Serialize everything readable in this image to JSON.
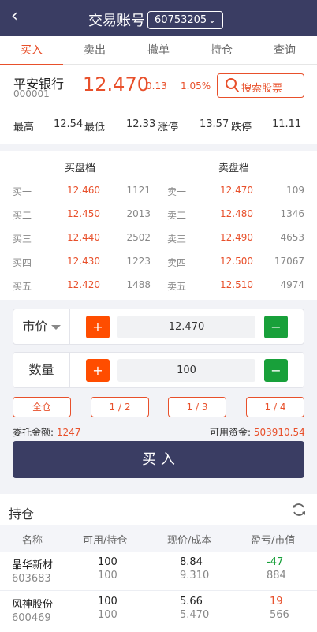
{
  "header": {
    "back_icon": "chevron-left-icon",
    "title": "交易账号",
    "account": "60753205"
  },
  "tabs": [
    "买入",
    "卖出",
    "撤单",
    "持仓",
    "查询"
  ],
  "stock": {
    "name": "平安银行",
    "code": "000001",
    "price": "12.470",
    "change": "0.13",
    "change_pct": "1.05%",
    "search_label": "搜索股票",
    "high_label": "最高",
    "high": "12.54",
    "low_label": "最低",
    "low": "12.33",
    "limit_up_label": "涨停",
    "limit_up": "13.57",
    "limit_down_label": "跌停",
    "limit_down": "11.11"
  },
  "orderbook": {
    "buy_title": "买盘档",
    "sell_title": "卖盘档",
    "buy": [
      {
        "level": "买一",
        "price": "12.460",
        "volume": "1121"
      },
      {
        "level": "买二",
        "price": "12.450",
        "volume": "2013"
      },
      {
        "level": "买三",
        "price": "12.440",
        "volume": "2502"
      },
      {
        "level": "买四",
        "price": "12.430",
        "volume": "1223"
      },
      {
        "level": "买五",
        "price": "12.420",
        "volume": "1488"
      }
    ],
    "sell": [
      {
        "level": "卖一",
        "price": "12.470",
        "volume": "109"
      },
      {
        "level": "卖二",
        "price": "12.480",
        "volume": "1346"
      },
      {
        "level": "卖三",
        "price": "12.490",
        "volume": "4653"
      },
      {
        "level": "卖四",
        "price": "12.500",
        "volume": "17067"
      },
      {
        "level": "卖五",
        "price": "12.510",
        "volume": "4974"
      }
    ]
  },
  "order": {
    "price_type": "市价",
    "price_value": "12.470",
    "qty_label": "数量",
    "qty_value": "100",
    "plus": "+",
    "minus": "−",
    "fractions": [
      "全仓",
      "1 / 2",
      "1 / 3",
      "1 / 4"
    ],
    "amount_label": "委托金额:",
    "amount": "1247",
    "funds_label": "可用资金:",
    "funds": "503910.54",
    "submit_label": "买 入"
  },
  "positions": {
    "title": "持仓",
    "columns": [
      "名称",
      "可用/持仓",
      "现价/成本",
      "盈亏/市值"
    ],
    "rows": [
      {
        "name": "晶华新材",
        "code": "603683",
        "avail": "100",
        "hold": "100",
        "price": "8.84",
        "cost": "9.310",
        "pnl": "-47",
        "pnl_color": "#18a03a",
        "value": "884"
      },
      {
        "name": "风神股份",
        "code": "600469",
        "avail": "100",
        "hold": "100",
        "price": "5.66",
        "cost": "5.470",
        "pnl": "19",
        "pnl_color": "#e8502b",
        "value": "566"
      }
    ]
  },
  "colors": {
    "accent": "#e8502b",
    "header": "#3a3d63",
    "plus": "#ff4d00",
    "minus": "#18a03a"
  }
}
